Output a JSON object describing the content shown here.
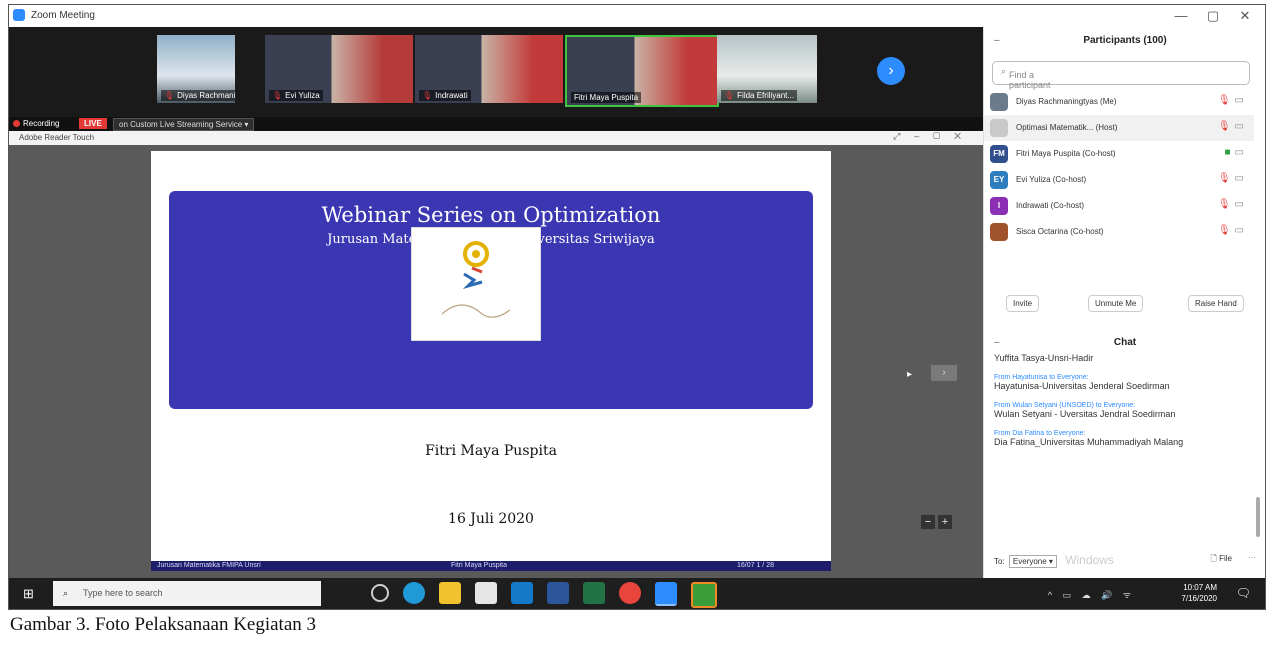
{
  "window": {
    "title": "Zoom Meeting",
    "min": "—",
    "max": "▢",
    "close": "✕"
  },
  "video_strip": {
    "tiles": [
      {
        "name": "Diyas Rachmani..."
      },
      {
        "name": "Evi Yuliza"
      },
      {
        "name": "Indrawati"
      },
      {
        "name": "Fitri Maya Puspita"
      },
      {
        "name": "Filda Efriliyant..."
      }
    ]
  },
  "recording": {
    "label": "Recording",
    "live": "LIVE",
    "service": "on Custom Live Streaming Service ▾"
  },
  "share_bar": {
    "doc": "Adobe Reader Touch"
  },
  "slide": {
    "title": "Webinar Series on Optimization",
    "subtitle": "Jurusan Matematika FMIPA Universitas Sriwijaya",
    "presenter": "Fitri Maya Puspita",
    "date": "16 Juli 2020",
    "footer_left": "Jurusan Matematika FMIPA Unsri",
    "footer_mid": "Fitri Maya Puspita",
    "footer_right": "16/07    1 / 28"
  },
  "participants": {
    "title": "Participants (100)",
    "search_placeholder": "Find a participant",
    "list": [
      {
        "name": "Diyas Rachmaningtyas (Me)",
        "initials": "",
        "color": "#6b7b8c"
      },
      {
        "name": "Optimasi Matematik... (Host)",
        "initials": "",
        "color": "#c9c9c9"
      },
      {
        "name": "Fitri Maya Puspita (Co-host)",
        "initials": "FM",
        "color": "#2f4f8f"
      },
      {
        "name": "Evi Yuliza (Co-host)",
        "initials": "EY",
        "color": "#2d7dbf"
      },
      {
        "name": "Indrawati (Co-host)",
        "initials": "I",
        "color": "#8b2fb5"
      },
      {
        "name": "Sisca Octarina (Co-host)",
        "initials": "",
        "color": "#a0522d"
      }
    ],
    "buttons": {
      "invite": "Invite",
      "unmute": "Unmute Me",
      "raise": "Raise Hand"
    }
  },
  "chat": {
    "title": "Chat",
    "messages": [
      {
        "from": "",
        "text": "Yuffita Tasya-Unsri-Hadir"
      },
      {
        "from": "From Hayatunisa to Everyone:",
        "text": "Hayatunisa-Universitas Jenderal Soedirman"
      },
      {
        "from": "From Wulan Setyani (UNSOED) to Everyone:",
        "text": "Wulan Setyani - Uversitas Jendral Soedirman"
      },
      {
        "from": "From Dia Fatina to Everyone:",
        "text": "Dia Fatina_Universitas Muhammadiyah Malang"
      }
    ],
    "to_label": "To:",
    "to_value": "Everyone ▾",
    "watermark": "Windows",
    "file": "File",
    "more": "···"
  },
  "taskbar": {
    "search": "Type here to search",
    "time": "10:07 AM",
    "date": "7/16/2020"
  },
  "caption": "Gambar 3. Foto Pelaksanaan Kegiatan 3"
}
